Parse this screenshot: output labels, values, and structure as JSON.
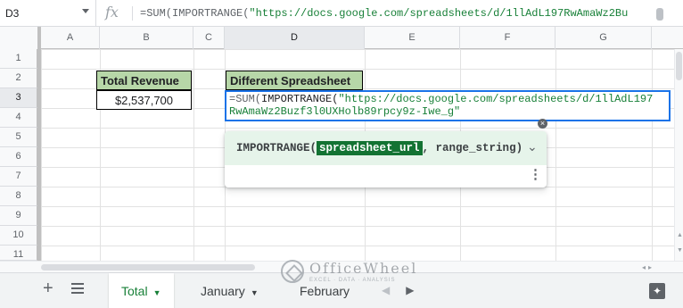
{
  "formula_bar": {
    "cell_ref": "D3",
    "fx": "fx",
    "formula_prefix": "=SUM(IMPORTRANGE(",
    "formula_string": "\"https://docs.google.com/spreadsheets/d/1llAdL197RwAmaWz2Bu"
  },
  "columns": [
    {
      "label": "A"
    },
    {
      "label": "B"
    },
    {
      "label": "C"
    },
    {
      "label": "D"
    },
    {
      "label": "E"
    },
    {
      "label": "F"
    },
    {
      "label": "G"
    }
  ],
  "active_column": "D",
  "rows": [
    "1",
    "2",
    "3",
    "4",
    "5",
    "6",
    "7",
    "8",
    "9",
    "10",
    "11"
  ],
  "active_row": "3",
  "cells": {
    "b2_header": "Total Revenue",
    "b3_value": "$2,537,700",
    "d2_header": "Different Spreadsheet"
  },
  "editor": {
    "fn_name": "=SUM(",
    "fn_inner": "IMPORTRANGE(",
    "line1_string": "\"https://docs.google.com/spreadsheets/d/1llAdL197",
    "line2_string": "RwAmaWz2Buzf3l0UXHolb89rpcy9z-Iwe_g\""
  },
  "tooltip": {
    "fn_open": "IMPORTRANGE(",
    "arg_active": "spreadsheet_url",
    "rest": ", range_string)",
    "chevron": "⌄",
    "more": "⋮"
  },
  "sheet_tabs": {
    "add": "+",
    "tabs": [
      {
        "label": "Total",
        "active": true
      },
      {
        "label": "January",
        "active": false
      },
      {
        "label": "February",
        "active": false
      }
    ]
  },
  "watermark": {
    "name": "OfficeWheel",
    "tagline": "EXCEL · DATA · ANALYSIS"
  },
  "colors": {
    "accent_blue": "#1a73e8",
    "header_green": "#b7d7a8",
    "active_tab_green": "#188038",
    "tooltip_arg_green": "#137333"
  },
  "icons": [
    "caret-down-icon",
    "fx-icon",
    "error-icon",
    "chevron-down-icon",
    "more-vert-icon",
    "add-icon",
    "all-sheets-icon",
    "explore-icon"
  ]
}
